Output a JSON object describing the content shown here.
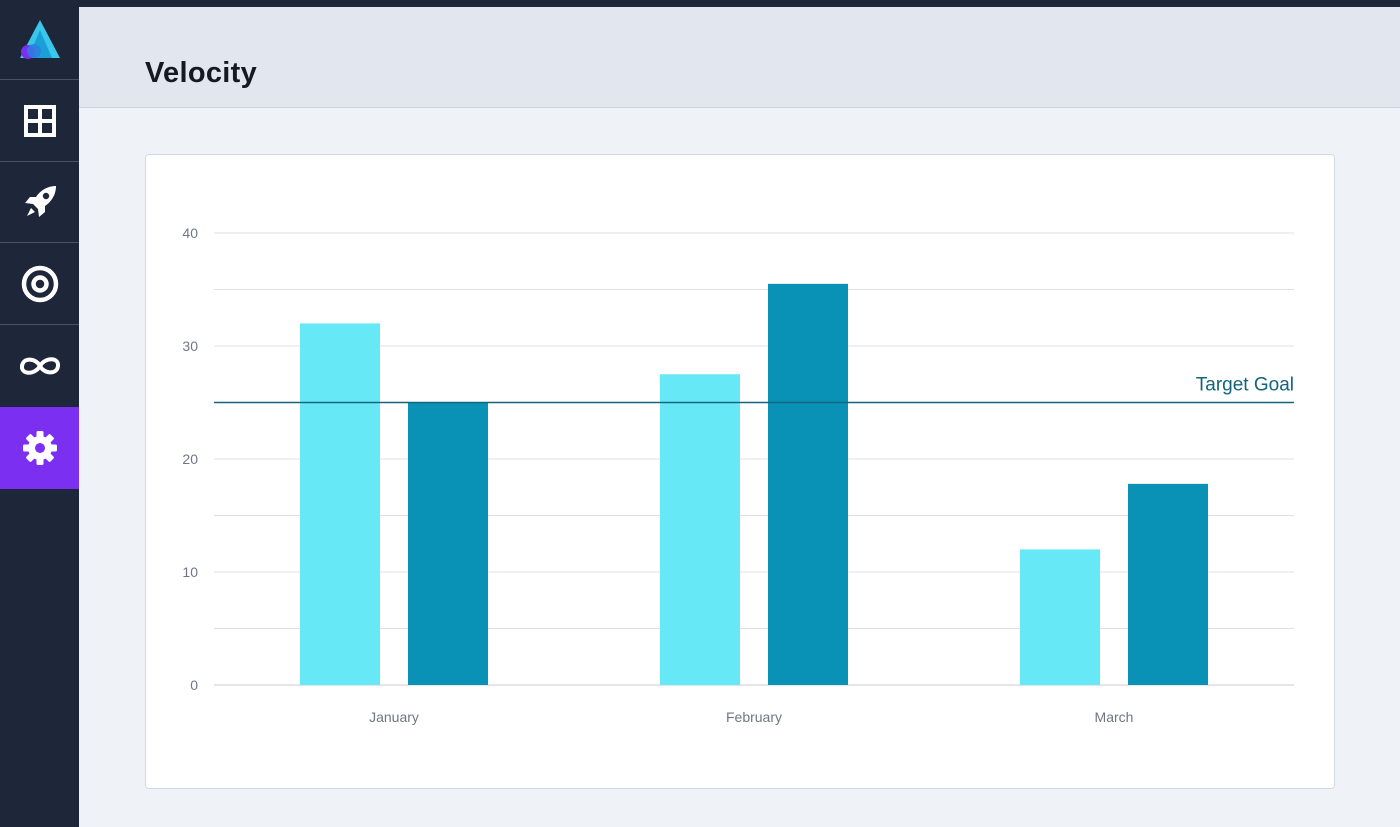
{
  "app": {
    "page_title": "Velocity"
  },
  "sidebar": {
    "items": [
      {
        "icon": "logo-icon",
        "active": false
      },
      {
        "icon": "dashboard-grid-icon",
        "active": false
      },
      {
        "icon": "rocket-icon",
        "active": false
      },
      {
        "icon": "target-icon",
        "active": false
      },
      {
        "icon": "infinity-loop-icon",
        "active": false
      },
      {
        "icon": "gear-icon",
        "active": true
      }
    ],
    "active_color": "#7b2ff0"
  },
  "chart_data": {
    "type": "bar",
    "categories": [
      "January",
      "February",
      "March"
    ],
    "series": [
      {
        "values": [
          32,
          27.5,
          12
        ],
        "color": "#67e8f6"
      },
      {
        "values": [
          25,
          35.5,
          17.8
        ],
        "color": "#0a92b6"
      }
    ],
    "ylim": [
      0,
      40
    ],
    "yticks": [
      0,
      10,
      20,
      30,
      40
    ],
    "grid": true,
    "reference_line": {
      "label": "Target Goal",
      "value": 25,
      "color": "#12647f"
    },
    "xlabel": "",
    "ylabel": ""
  }
}
